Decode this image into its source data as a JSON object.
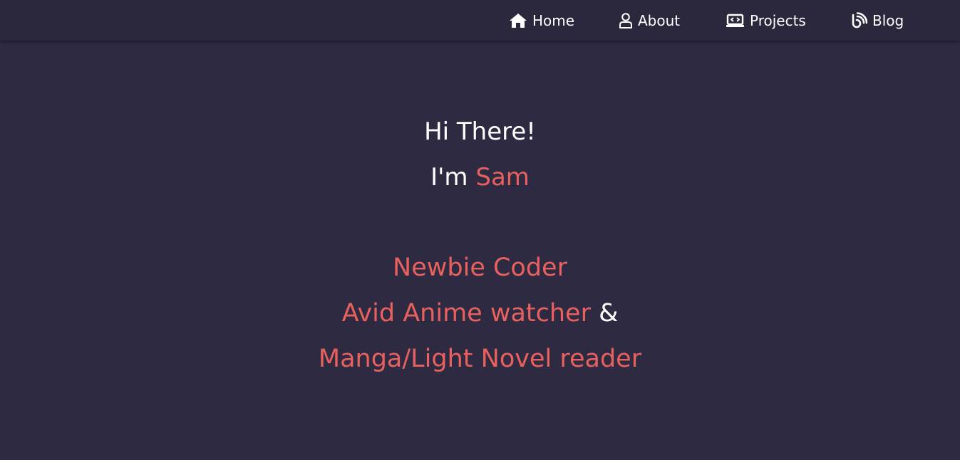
{
  "nav": {
    "items": [
      {
        "label": "Home",
        "icon": "home-icon"
      },
      {
        "label": "About",
        "icon": "user-icon"
      },
      {
        "label": "Projects",
        "icon": "laptop-code-icon"
      },
      {
        "label": "Blog",
        "icon": "blog-icon"
      }
    ]
  },
  "hero": {
    "greeting": "Hi There!",
    "intro_prefix": "I'm",
    "name": "Sam",
    "roles": {
      "line1": "Newbie Coder",
      "line2": "Avid Anime watcher",
      "line2_suffix": "&",
      "line3": "Manga/Light Novel reader"
    }
  },
  "colors": {
    "background": "#2e2a41",
    "navbar": "#2b283d",
    "accent": "#e8615e",
    "text": "#ffffff"
  }
}
